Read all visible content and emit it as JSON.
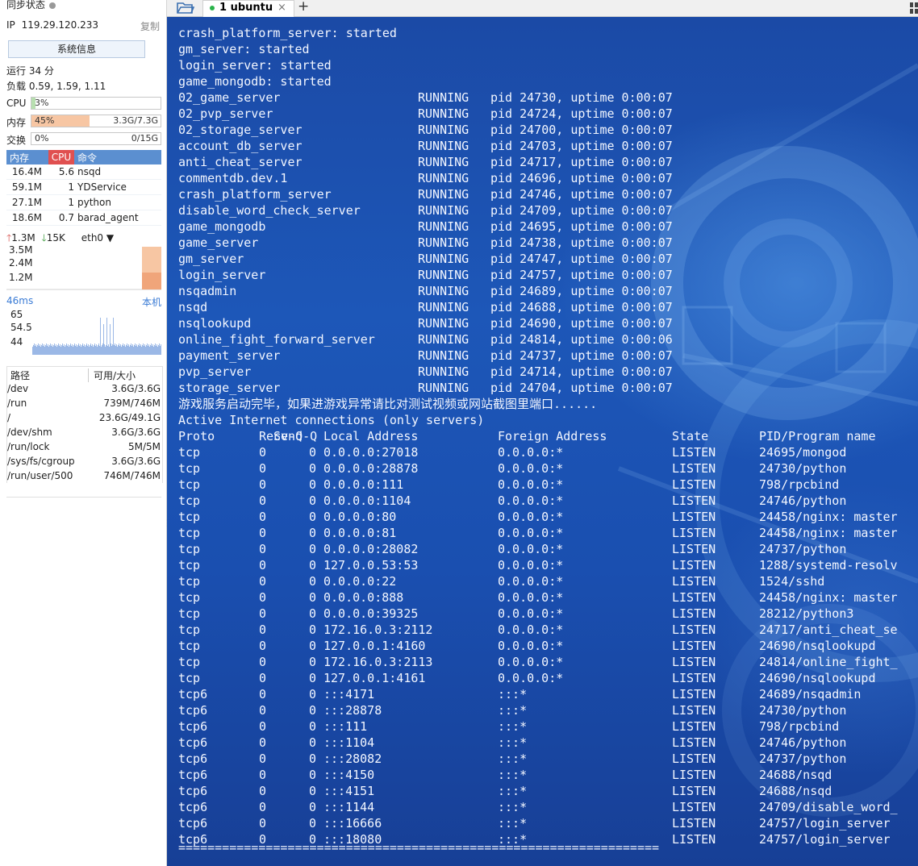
{
  "sidebar": {
    "sync_label": "同步状态",
    "ip_label": "IP",
    "ip_value": "119.29.120.233",
    "copy_label": "复制",
    "sysinfo_button": "系统信息",
    "uptime_text": "运行 34 分",
    "load_text": "负载 0.59, 1.59, 1.11",
    "meters": [
      {
        "label": "CPU",
        "percent_text": "3%",
        "amount": "",
        "fill_percent": 3,
        "color": "#b8dfb0"
      },
      {
        "label": "内存",
        "percent_text": "45%",
        "amount": "3.3G/7.3G",
        "fill_percent": 45,
        "color": "#f7c6a3"
      },
      {
        "label": "交换",
        "percent_text": "0%",
        "amount": "0/15G",
        "fill_percent": 0,
        "color": "#b8dfb0"
      }
    ],
    "process_table": {
      "headers": [
        "内存",
        "CPU",
        "命令"
      ],
      "rows": [
        {
          "mem": "16.4M",
          "cpu": "5.6",
          "cmd": "nsqd"
        },
        {
          "mem": "59.1M",
          "cpu": "1",
          "cmd": "YDService"
        },
        {
          "mem": "27.1M",
          "cpu": "1",
          "cmd": "python"
        },
        {
          "mem": "18.6M",
          "cpu": "0.7",
          "cmd": "barad_agent"
        }
      ]
    },
    "network": {
      "up_speed": "1.3M",
      "down_speed": "15K",
      "interface": "eth0",
      "chart_ticks": [
        "3.5M",
        "2.4M",
        "1.2M"
      ]
    },
    "latency": {
      "current": "46ms",
      "host_label": "本机",
      "chart_ticks": [
        "65",
        "54.5",
        "44"
      ]
    },
    "disks": {
      "headers": [
        "路径",
        "可用/大小"
      ],
      "rows": [
        {
          "path": "/dev",
          "usage": "3.6G/3.6G"
        },
        {
          "path": "/run",
          "usage": "739M/746M"
        },
        {
          "path": "/",
          "usage": "23.6G/49.1G"
        },
        {
          "path": "/dev/shm",
          "usage": "3.6G/3.6G"
        },
        {
          "path": "/run/lock",
          "usage": "5M/5M"
        },
        {
          "path": "/sys/fs/cgroup",
          "usage": "3.6G/3.6G"
        },
        {
          "path": "/run/user/500",
          "usage": "746M/746M"
        }
      ]
    }
  },
  "tabs": {
    "items": [
      {
        "label": "1 ubuntu",
        "close": "×"
      }
    ],
    "add_label": "+"
  },
  "terminal": {
    "started_lines": [
      "crash_platform_server: started",
      "gm_server: started",
      "login_server: started",
      "game_mongodb: started"
    ],
    "processes": [
      {
        "name": "02_game_server",
        "status": "RUNNING",
        "info": "pid 24730, uptime 0:00:07"
      },
      {
        "name": "02_pvp_server",
        "status": "RUNNING",
        "info": "pid 24724, uptime 0:00:07"
      },
      {
        "name": "02_storage_server",
        "status": "RUNNING",
        "info": "pid 24700, uptime 0:00:07"
      },
      {
        "name": "account_db_server",
        "status": "RUNNING",
        "info": "pid 24703, uptime 0:00:07"
      },
      {
        "name": "anti_cheat_server",
        "status": "RUNNING",
        "info": "pid 24717, uptime 0:00:07"
      },
      {
        "name": "commentdb.dev.1",
        "status": "RUNNING",
        "info": "pid 24696, uptime 0:00:07"
      },
      {
        "name": "crash_platform_server",
        "status": "RUNNING",
        "info": "pid 24746, uptime 0:00:07"
      },
      {
        "name": "disable_word_check_server",
        "status": "RUNNING",
        "info": "pid 24709, uptime 0:00:07"
      },
      {
        "name": "game_mongodb",
        "status": "RUNNING",
        "info": "pid 24695, uptime 0:00:07"
      },
      {
        "name": "game_server",
        "status": "RUNNING",
        "info": "pid 24738, uptime 0:00:07"
      },
      {
        "name": "gm_server",
        "status": "RUNNING",
        "info": "pid 24747, uptime 0:00:07"
      },
      {
        "name": "login_server",
        "status": "RUNNING",
        "info": "pid 24757, uptime 0:00:07"
      },
      {
        "name": "nsqadmin",
        "status": "RUNNING",
        "info": "pid 24689, uptime 0:00:07"
      },
      {
        "name": "nsqd",
        "status": "RUNNING",
        "info": "pid 24688, uptime 0:00:07"
      },
      {
        "name": "nsqlookupd",
        "status": "RUNNING",
        "info": "pid 24690, uptime 0:00:07"
      },
      {
        "name": "online_fight_forward_server",
        "status": "RUNNING",
        "info": "pid 24814, uptime 0:00:06"
      },
      {
        "name": "payment_server",
        "status": "RUNNING",
        "info": "pid 24737, uptime 0:00:07"
      },
      {
        "name": "pvp_server",
        "status": "RUNNING",
        "info": "pid 24714, uptime 0:00:07"
      },
      {
        "name": "storage_server",
        "status": "RUNNING",
        "info": "pid 24704, uptime 0:00:07"
      }
    ],
    "message": "游戏服务启动完毕，如果进游戏异常请比对测试视频或网站截图里端口......",
    "netstat_title": "Active Internet connections (only servers)",
    "netstat_header": {
      "proto": "Proto",
      "recvq": "Recv-Q",
      "sendq": "Send-Q",
      "local": "Local Address",
      "foreign": "Foreign Address",
      "state": "State",
      "pid": "PID/Program name"
    },
    "connections": [
      {
        "proto": "tcp",
        "recvq": "0",
        "sendq": "0",
        "local": "0.0.0.0:27018",
        "foreign": "0.0.0.0:*",
        "state": "LISTEN",
        "pid": "24695/mongod"
      },
      {
        "proto": "tcp",
        "recvq": "0",
        "sendq": "0",
        "local": "0.0.0.0:28878",
        "foreign": "0.0.0.0:*",
        "state": "LISTEN",
        "pid": "24730/python"
      },
      {
        "proto": "tcp",
        "recvq": "0",
        "sendq": "0",
        "local": "0.0.0.0:111",
        "foreign": "0.0.0.0:*",
        "state": "LISTEN",
        "pid": "798/rpcbind"
      },
      {
        "proto": "tcp",
        "recvq": "0",
        "sendq": "0",
        "local": "0.0.0.0:1104",
        "foreign": "0.0.0.0:*",
        "state": "LISTEN",
        "pid": "24746/python"
      },
      {
        "proto": "tcp",
        "recvq": "0",
        "sendq": "0",
        "local": "0.0.0.0:80",
        "foreign": "0.0.0.0:*",
        "state": "LISTEN",
        "pid": "24458/nginx: master"
      },
      {
        "proto": "tcp",
        "recvq": "0",
        "sendq": "0",
        "local": "0.0.0.0:81",
        "foreign": "0.0.0.0:*",
        "state": "LISTEN",
        "pid": "24458/nginx: master"
      },
      {
        "proto": "tcp",
        "recvq": "0",
        "sendq": "0",
        "local": "0.0.0.0:28082",
        "foreign": "0.0.0.0:*",
        "state": "LISTEN",
        "pid": "24737/python"
      },
      {
        "proto": "tcp",
        "recvq": "0",
        "sendq": "0",
        "local": "127.0.0.53:53",
        "foreign": "0.0.0.0:*",
        "state": "LISTEN",
        "pid": "1288/systemd-resolv"
      },
      {
        "proto": "tcp",
        "recvq": "0",
        "sendq": "0",
        "local": "0.0.0.0:22",
        "foreign": "0.0.0.0:*",
        "state": "LISTEN",
        "pid": "1524/sshd"
      },
      {
        "proto": "tcp",
        "recvq": "0",
        "sendq": "0",
        "local": "0.0.0.0:888",
        "foreign": "0.0.0.0:*",
        "state": "LISTEN",
        "pid": "24458/nginx: master"
      },
      {
        "proto": "tcp",
        "recvq": "0",
        "sendq": "0",
        "local": "0.0.0.0:39325",
        "foreign": "0.0.0.0:*",
        "state": "LISTEN",
        "pid": "28212/python3"
      },
      {
        "proto": "tcp",
        "recvq": "0",
        "sendq": "0",
        "local": "172.16.0.3:2112",
        "foreign": "0.0.0.0:*",
        "state": "LISTEN",
        "pid": "24717/anti_cheat_se"
      },
      {
        "proto": "tcp",
        "recvq": "0",
        "sendq": "0",
        "local": "127.0.0.1:4160",
        "foreign": "0.0.0.0:*",
        "state": "LISTEN",
        "pid": "24690/nsqlookupd"
      },
      {
        "proto": "tcp",
        "recvq": "0",
        "sendq": "0",
        "local": "172.16.0.3:2113",
        "foreign": "0.0.0.0:*",
        "state": "LISTEN",
        "pid": "24814/online_fight_"
      },
      {
        "proto": "tcp",
        "recvq": "0",
        "sendq": "0",
        "local": "127.0.0.1:4161",
        "foreign": "0.0.0.0:*",
        "state": "LISTEN",
        "pid": "24690/nsqlookupd"
      },
      {
        "proto": "tcp6",
        "recvq": "0",
        "sendq": "0",
        "local": ":::4171",
        "foreign": ":::*",
        "state": "LISTEN",
        "pid": "24689/nsqadmin"
      },
      {
        "proto": "tcp6",
        "recvq": "0",
        "sendq": "0",
        "local": ":::28878",
        "foreign": ":::*",
        "state": "LISTEN",
        "pid": "24730/python"
      },
      {
        "proto": "tcp6",
        "recvq": "0",
        "sendq": "0",
        "local": ":::111",
        "foreign": ":::*",
        "state": "LISTEN",
        "pid": "798/rpcbind"
      },
      {
        "proto": "tcp6",
        "recvq": "0",
        "sendq": "0",
        "local": ":::1104",
        "foreign": ":::*",
        "state": "LISTEN",
        "pid": "24746/python"
      },
      {
        "proto": "tcp6",
        "recvq": "0",
        "sendq": "0",
        "local": ":::28082",
        "foreign": ":::*",
        "state": "LISTEN",
        "pid": "24737/python"
      },
      {
        "proto": "tcp6",
        "recvq": "0",
        "sendq": "0",
        "local": ":::4150",
        "foreign": ":::*",
        "state": "LISTEN",
        "pid": "24688/nsqd"
      },
      {
        "proto": "tcp6",
        "recvq": "0",
        "sendq": "0",
        "local": ":::4151",
        "foreign": ":::*",
        "state": "LISTEN",
        "pid": "24688/nsqd"
      },
      {
        "proto": "tcp6",
        "recvq": "0",
        "sendq": "0",
        "local": ":::1144",
        "foreign": ":::*",
        "state": "LISTEN",
        "pid": "24709/disable_word_"
      },
      {
        "proto": "tcp6",
        "recvq": "0",
        "sendq": "0",
        "local": ":::16666",
        "foreign": ":::*",
        "state": "LISTEN",
        "pid": "24757/login_server"
      },
      {
        "proto": "tcp6",
        "recvq": "0",
        "sendq": "0",
        "local": ":::18080",
        "foreign": ":::*",
        "state": "LISTEN",
        "pid": "24757/login_server"
      }
    ],
    "separator": "=================================================================="
  },
  "colors": {
    "accent": "#5b8fd0",
    "cpu_header": "#e05050",
    "terminal_text": "#f2f6ff",
    "up_arrow": "#d9534f",
    "down_arrow": "#3a9a3a"
  }
}
